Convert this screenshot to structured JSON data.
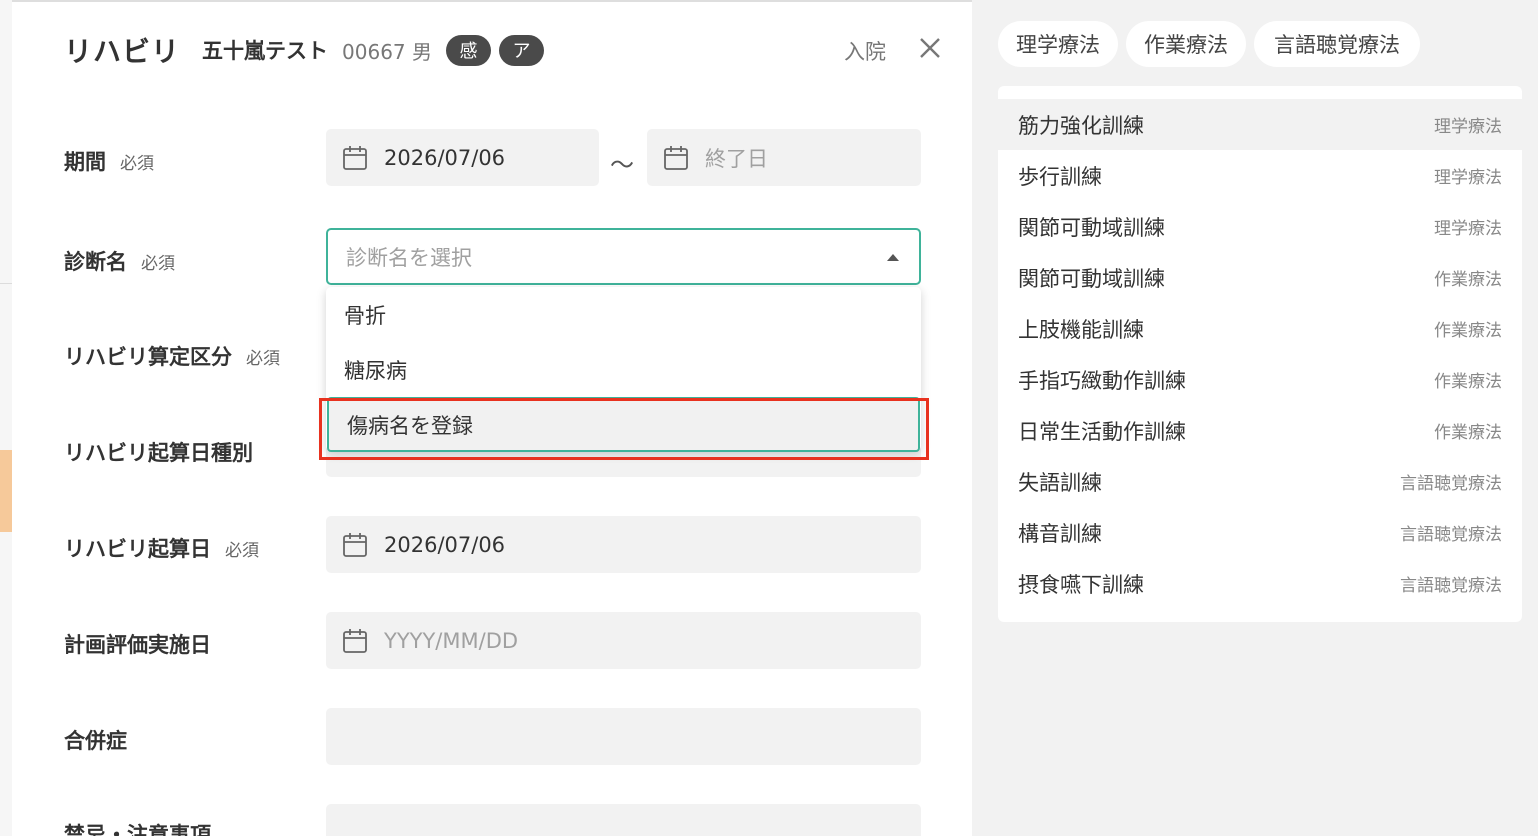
{
  "header": {
    "title": "リハビリ",
    "patient_name": "五十嵐テスト",
    "patient_id": "00667 男",
    "badges": [
      "感",
      "ア"
    ],
    "status": "入院"
  },
  "form": {
    "period": {
      "label": "期間",
      "required": "必須",
      "start": "2026/07/06",
      "tilde": "～",
      "end_placeholder": "終了日"
    },
    "diagnosis": {
      "label": "診断名",
      "required": "必須",
      "placeholder": "診断名を選択",
      "options": [
        "骨折",
        "糖尿病",
        "傷病名を登録"
      ]
    },
    "category": {
      "label": "リハビリ算定区分",
      "required": "必須"
    },
    "start_type": {
      "label": "リハビリ起算日種別"
    },
    "start_date": {
      "label": "リハビリ起算日",
      "required": "必須",
      "value": "2026/07/06"
    },
    "eval_date": {
      "label": "計画評価実施日",
      "placeholder": "YYYY/MM/DD"
    },
    "complication": {
      "label": "合併症"
    },
    "caution": {
      "label": "禁忌・注意事項"
    }
  },
  "tabs": [
    "理学療法",
    "作業療法",
    "言語聴覚療法"
  ],
  "training_list": [
    {
      "name": "筋力強化訓練",
      "category": "理学療法"
    },
    {
      "name": "歩行訓練",
      "category": "理学療法"
    },
    {
      "name": "関節可動域訓練",
      "category": "理学療法"
    },
    {
      "name": "関節可動域訓練",
      "category": "作業療法"
    },
    {
      "name": "上肢機能訓練",
      "category": "作業療法"
    },
    {
      "name": "手指巧緻動作訓練",
      "category": "作業療法"
    },
    {
      "name": "日常生活動作訓練",
      "category": "作業療法"
    },
    {
      "name": "失語訓練",
      "category": "言語聴覚療法"
    },
    {
      "name": "構音訓練",
      "category": "言語聴覚療法"
    },
    {
      "name": "摂食嚥下訓練",
      "category": "言語聴覚療法"
    }
  ],
  "colors": {
    "accent": "#3fb39a",
    "highlight": "#e8321f",
    "badge": "#4a4a4a"
  }
}
